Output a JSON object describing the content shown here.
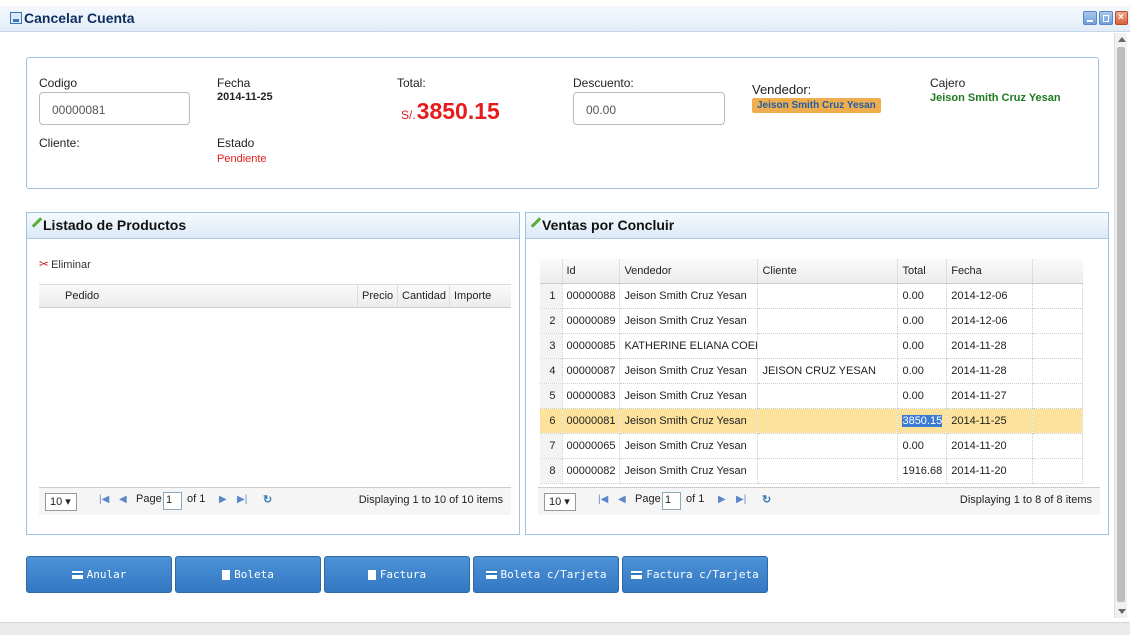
{
  "window": {
    "title": "Cancelar Cuenta"
  },
  "info": {
    "codigo_label": "Codigo",
    "codigo_value": "00000081",
    "fecha_label": "Fecha",
    "fecha_value": "2014-11-25",
    "total_label": "Total:",
    "total_currency": "S/.",
    "total_value": "3850.15",
    "descuento_label": "Descuento:",
    "descuento_value": "00.00",
    "vendedor_label": "Vendedor:",
    "vendedor_value": "Jeison Smith Cruz Yesan",
    "cajero_label": "Cajero",
    "cajero_value": "Jeison Smith Cruz Yesan",
    "cliente_label": "Cliente:",
    "estado_label": "Estado",
    "estado_value": "Pendiente"
  },
  "productos": {
    "title": "Listado de Productos",
    "eliminar_label": "Eliminar",
    "columns": [
      "Pedido",
      "Precio",
      "Cantidad",
      "Importe"
    ],
    "pager": {
      "page_size": "10",
      "page_label": "Page",
      "page_value": "1",
      "of_label": "of 1",
      "display": "Displaying 1 to 10 of 10 items"
    }
  },
  "ventas": {
    "title": "Ventas por Concluir",
    "columns": [
      "Id",
      "Vendedor",
      "Cliente",
      "Total",
      "Fecha"
    ],
    "rows": [
      {
        "n": "1",
        "id": "00000088",
        "vendedor": "Jeison Smith Cruz Yesan",
        "cliente": "",
        "total": "0.00",
        "fecha": "2014-12-06"
      },
      {
        "n": "2",
        "id": "00000089",
        "vendedor": "Jeison Smith Cruz Yesan",
        "cliente": "",
        "total": "0.00",
        "fecha": "2014-12-06"
      },
      {
        "n": "3",
        "id": "00000085",
        "vendedor": "KATHERINE ELIANA COELL",
        "cliente": "",
        "total": "0.00",
        "fecha": "2014-11-28"
      },
      {
        "n": "4",
        "id": "00000087",
        "vendedor": "Jeison Smith Cruz Yesan",
        "cliente": "JEISON CRUZ YESAN",
        "total": "0.00",
        "fecha": "2014-11-28"
      },
      {
        "n": "5",
        "id": "00000083",
        "vendedor": "Jeison Smith Cruz Yesan",
        "cliente": "",
        "total": "0.00",
        "fecha": "2014-11-27"
      },
      {
        "n": "6",
        "id": "00000081",
        "vendedor": "Jeison Smith Cruz Yesan",
        "cliente": "",
        "total": "3850.15",
        "fecha": "2014-11-25"
      },
      {
        "n": "7",
        "id": "00000065",
        "vendedor": "Jeison Smith Cruz Yesan",
        "cliente": "",
        "total": "0.00",
        "fecha": "2014-11-20"
      },
      {
        "n": "8",
        "id": "00000082",
        "vendedor": "Jeison Smith Cruz Yesan",
        "cliente": "",
        "total": "1916.68",
        "fecha": "2014-11-20"
      }
    ],
    "pager": {
      "page_size": "10",
      "page_label": "Page",
      "page_value": "1",
      "of_label": "of 1",
      "display": "Displaying 1 to 8 of 8 items"
    }
  },
  "buttons": {
    "anular": "Anular",
    "boleta": "Boleta",
    "factura": "Factura",
    "boleta_tarjeta": "Boleta c/Tarjeta",
    "factura_tarjeta": "Factura c/Tarjeta"
  },
  "colors": {
    "accent": "#3378c3",
    "total": "#e61b1b",
    "estado": "#e02020",
    "cajero": "#1e7a1e",
    "selected_row": "#fde29b"
  }
}
